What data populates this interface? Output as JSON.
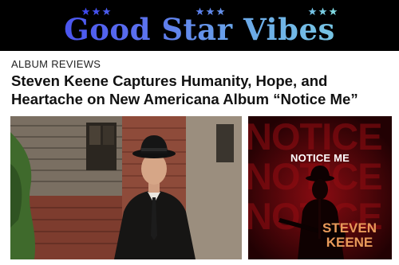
{
  "site": {
    "logo_text": "Good Star Vibes",
    "logo_gradient": [
      "#3b3df0",
      "#6aa7e8",
      "#7fd8e0"
    ],
    "header_background": "#000000",
    "star_icon": "star-icon"
  },
  "article": {
    "category": "ALBUM REVIEWS",
    "title": "Steven Keene Captures Humanity, Hope, and Heartache on New Americana Album “Notice Me”"
  },
  "album_cover": {
    "title": "NOTICE ME",
    "background_text": "NOTICE ME",
    "artist_line1": "STEVEN",
    "artist_line2": "KEENE",
    "background_color": "#2a0204",
    "accent_color": "#e89a5a"
  }
}
